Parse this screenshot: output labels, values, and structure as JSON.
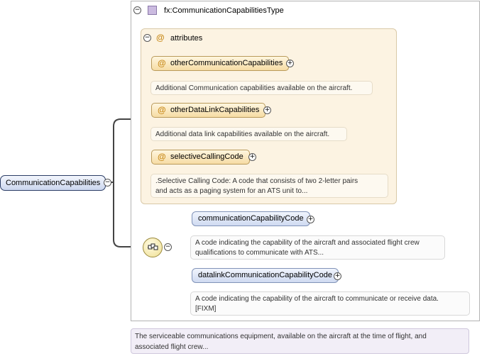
{
  "root": {
    "label": "CommunicationCapabilities",
    "toggle": "−"
  },
  "type": {
    "label": "fx:CommunicationCapabilitiesType",
    "toggle": "−"
  },
  "attributes": {
    "header": "attributes",
    "at_symbol": "@",
    "toggle": "−",
    "items": [
      {
        "name": "otherCommunicationCapabilities",
        "toggle": "+",
        "doc": "Additional Communication capabilities available on the aircraft."
      },
      {
        "name": "otherDataLinkCapabilities",
        "toggle": "+",
        "doc": "Additional data link capabilities available on the aircraft."
      },
      {
        "name": "selectiveCallingCode",
        "toggle": "+",
        "doc_lines": [
          ".Selective Calling Code: A code that consists of two 2-letter pairs",
          "and acts as a paging system for an ATS unit to..."
        ]
      }
    ]
  },
  "sequence": {
    "toggle": "−",
    "elements": [
      {
        "name": "communicationCapabilityCode",
        "toggle": "+",
        "doc_lines": [
          "A code indicating the capability of the aircraft and associated flight crew",
          "qualifications to communicate with ATS..."
        ]
      },
      {
        "name": "datalinkCommunicationCapabilityCode",
        "toggle": "+",
        "doc_lines": [
          "A code indicating the capability of the aircraft to communicate or receive data.",
          "[FIXM]"
        ]
      }
    ]
  },
  "root_doc_lines": [
    "The serviceable communications equipment, available on the aircraft at the time of flight, and",
    "associated flight crew..."
  ]
}
